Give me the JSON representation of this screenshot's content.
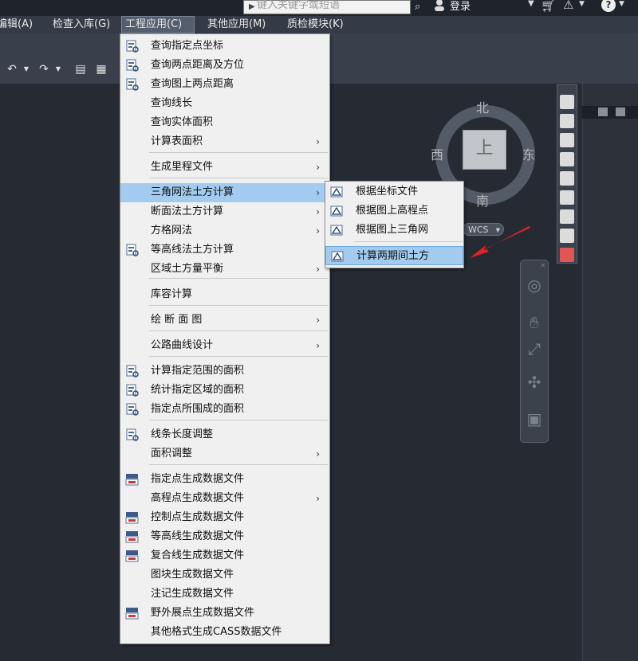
{
  "title_bar": {
    "search_placeholder": "键入关键字或短语",
    "login_label": "登录"
  },
  "menubar": {
    "items": [
      "编辑(A)",
      "检查入库(G)",
      "工程应用(C)",
      "其他应用(M)",
      "质检模块(K)"
    ],
    "active_index": 2
  },
  "viewcube": {
    "north": "北",
    "south": "南",
    "east": "东",
    "west": "西",
    "top_face": "上",
    "wcs_label": "WCS"
  },
  "menu": {
    "items": [
      {
        "label": "查询指定点坐标",
        "icon": "query-point-icon",
        "submenu": false
      },
      {
        "label": "查询两点距离及方位",
        "icon": "query-distance-icon",
        "submenu": false
      },
      {
        "label": "查询图上两点距离",
        "icon": "query-map-distance-icon",
        "submenu": false
      },
      {
        "label": "查询线长",
        "icon": "",
        "submenu": false
      },
      {
        "label": "查询实体面积",
        "icon": "",
        "submenu": false
      },
      {
        "label": "计算表面积",
        "icon": "",
        "submenu": true
      },
      {
        "label": "生成里程文件",
        "icon": "",
        "submenu": true
      },
      {
        "label": "三角网法土方计算",
        "icon": "",
        "submenu": true,
        "highlighted": true
      },
      {
        "label": "断面法土方计算",
        "icon": "",
        "submenu": true
      },
      {
        "label": "方格网法",
        "icon": "",
        "submenu": true
      },
      {
        "label": "等高线法土方计算",
        "icon": "contour-volume-icon",
        "submenu": false
      },
      {
        "label": "区域土方量平衡",
        "icon": "",
        "submenu": true
      },
      {
        "label": "库容计算",
        "icon": "",
        "submenu": false
      },
      {
        "label": "绘 断 面 图",
        "icon": "",
        "submenu": true
      },
      {
        "label": "公路曲线设计",
        "icon": "",
        "submenu": true
      },
      {
        "label": "计算指定范围的面积",
        "icon": "area-range-icon",
        "submenu": false
      },
      {
        "label": "统计指定区域的面积",
        "icon": "area-stats-icon",
        "submenu": false
      },
      {
        "label": "指定点所围成的面积",
        "icon": "area-points-icon",
        "submenu": false
      },
      {
        "label": "线条长度调整",
        "icon": "line-adjust-icon",
        "submenu": false
      },
      {
        "label": "面积调整",
        "icon": "",
        "submenu": true
      },
      {
        "label": "指定点生成数据文件",
        "icon": "dat-point-icon",
        "submenu": false
      },
      {
        "label": "高程点生成数据文件",
        "icon": "",
        "submenu": true
      },
      {
        "label": "控制点生成数据文件",
        "icon": "dat-control-icon",
        "submenu": false
      },
      {
        "label": "等高线生成数据文件",
        "icon": "dat-contour-icon",
        "submenu": false
      },
      {
        "label": "复合线生成数据文件",
        "icon": "dat-polyline-icon",
        "submenu": false
      },
      {
        "label": "图块生成数据文件",
        "icon": "",
        "submenu": false
      },
      {
        "label": "注记生成数据文件",
        "icon": "",
        "submenu": false
      },
      {
        "label": "野外展点生成数据文件",
        "icon": "field-points-icon",
        "submenu": false
      },
      {
        "label": "其他格式生成CASS数据文件",
        "icon": "",
        "submenu": false
      }
    ],
    "submenu_arrow": "›"
  },
  "submenu": {
    "items": [
      {
        "label": "根据坐标文件",
        "icon": "tin-file-icon"
      },
      {
        "label": "根据图上高程点",
        "icon": "tin-elevation-icon"
      },
      {
        "label": "根据图上三角网",
        "icon": "tin-mesh-icon"
      },
      {
        "label": "计算两期间土方",
        "icon": "two-period-volume-icon",
        "highlighted": true
      }
    ]
  },
  "colors": {
    "menu_bg": "#f0f0f0",
    "highlight": "#a2cbef",
    "canvas": "#262a32",
    "annotation_arrow": "#e02424"
  }
}
